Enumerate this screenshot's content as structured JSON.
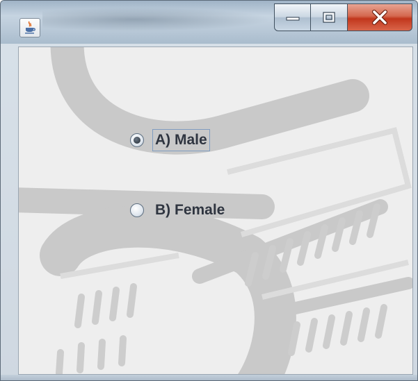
{
  "window": {
    "title": "",
    "icon": "java-coffee-cup-icon",
    "controls": {
      "minimize_icon": "minimize-icon",
      "maximize_icon": "maximize-icon",
      "close_icon": "close-icon",
      "close_color": "#c8432a"
    }
  },
  "form": {
    "options": [
      {
        "label": "A) Male",
        "selected": true
      },
      {
        "label": "B) Female",
        "selected": false
      }
    ]
  }
}
